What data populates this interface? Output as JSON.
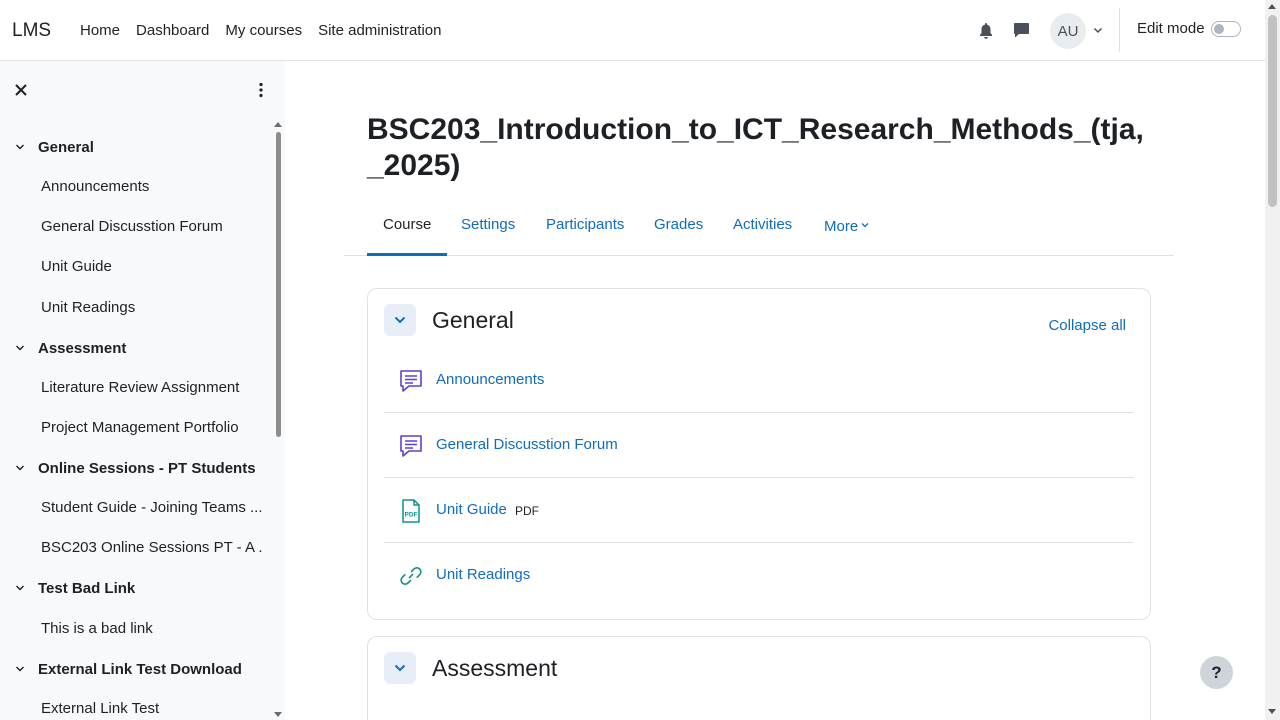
{
  "brand": "LMS",
  "primary_nav": [
    "Home",
    "Dashboard",
    "My courses",
    "Site administration"
  ],
  "user": {
    "initials": "AU"
  },
  "edit_mode_label": "Edit mode",
  "course_index": {
    "sections": [
      {
        "title": "General",
        "items": [
          "Announcements",
          "General Discusstion Forum",
          "Unit Guide",
          "Unit Readings"
        ]
      },
      {
        "title": "Assessment",
        "items": [
          "Literature Review Assignment",
          "Project Management Portfolio"
        ]
      },
      {
        "title": "Online Sessions - PT Students",
        "items": [
          "Student Guide - Joining Teams ...",
          "BSC203 Online Sessions PT - A ..."
        ]
      },
      {
        "title": "Test Bad Link",
        "items": [
          "This is a bad link"
        ]
      },
      {
        "title": "External Link Test Download",
        "items": [
          "External Link Test"
        ]
      }
    ]
  },
  "course_title": "BSC203_Introduction_to_ICT_Research_Methods_(tja,_2025)",
  "tabs": [
    "Course",
    "Settings",
    "Participants",
    "Grades",
    "Activities",
    "More"
  ],
  "collapse_all": "Collapse all",
  "sections": [
    {
      "title": "General",
      "activities": [
        {
          "name": "Announcements",
          "icon": "forum-icon",
          "badge": ""
        },
        {
          "name": "General Discusstion Forum",
          "icon": "forum-icon",
          "badge": ""
        },
        {
          "name": "Unit Guide",
          "icon": "pdf-icon",
          "badge": "PDF"
        },
        {
          "name": "Unit Readings",
          "icon": "link-icon",
          "badge": ""
        }
      ]
    },
    {
      "title": "Assessment",
      "activities": []
    }
  ],
  "help_label": "?",
  "colors": {
    "link": "#0f6cbf",
    "forum": "#5d3fd3",
    "resource": "#0d9488",
    "drawer_bg": "#f8f9fa"
  }
}
